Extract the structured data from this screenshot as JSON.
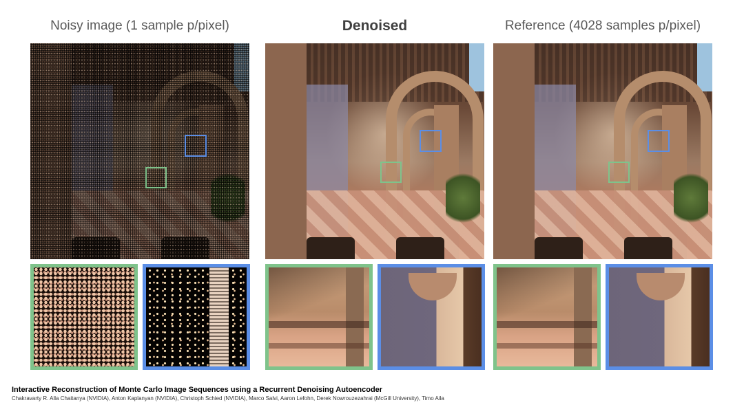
{
  "columns": [
    {
      "title": "Noisy image (1 sample p/pixel)",
      "bold": false,
      "style": "noisy"
    },
    {
      "title": "Denoised",
      "bold": true,
      "style": "clean"
    },
    {
      "title": "Reference (4028 samples p/pixel)",
      "bold": false,
      "style": "clean"
    }
  ],
  "colors": {
    "green_box": "#7fc38b",
    "blue_box": "#5b8ee6"
  },
  "footer": {
    "paper_title": "Interactive Reconstruction of Monte Carlo Image Sequences using a Recurrent Denoising Autoencoder",
    "authors": "Chakravarty R. Alla Chaitanya (NVIDIA), Anton Kaplanyan (NVIDIA), Christoph Schied (NVIDIA), Marco Salvi, Aaron Lefohn, Derek Nowrouzezahrai (McGill University), Timo Aila"
  }
}
